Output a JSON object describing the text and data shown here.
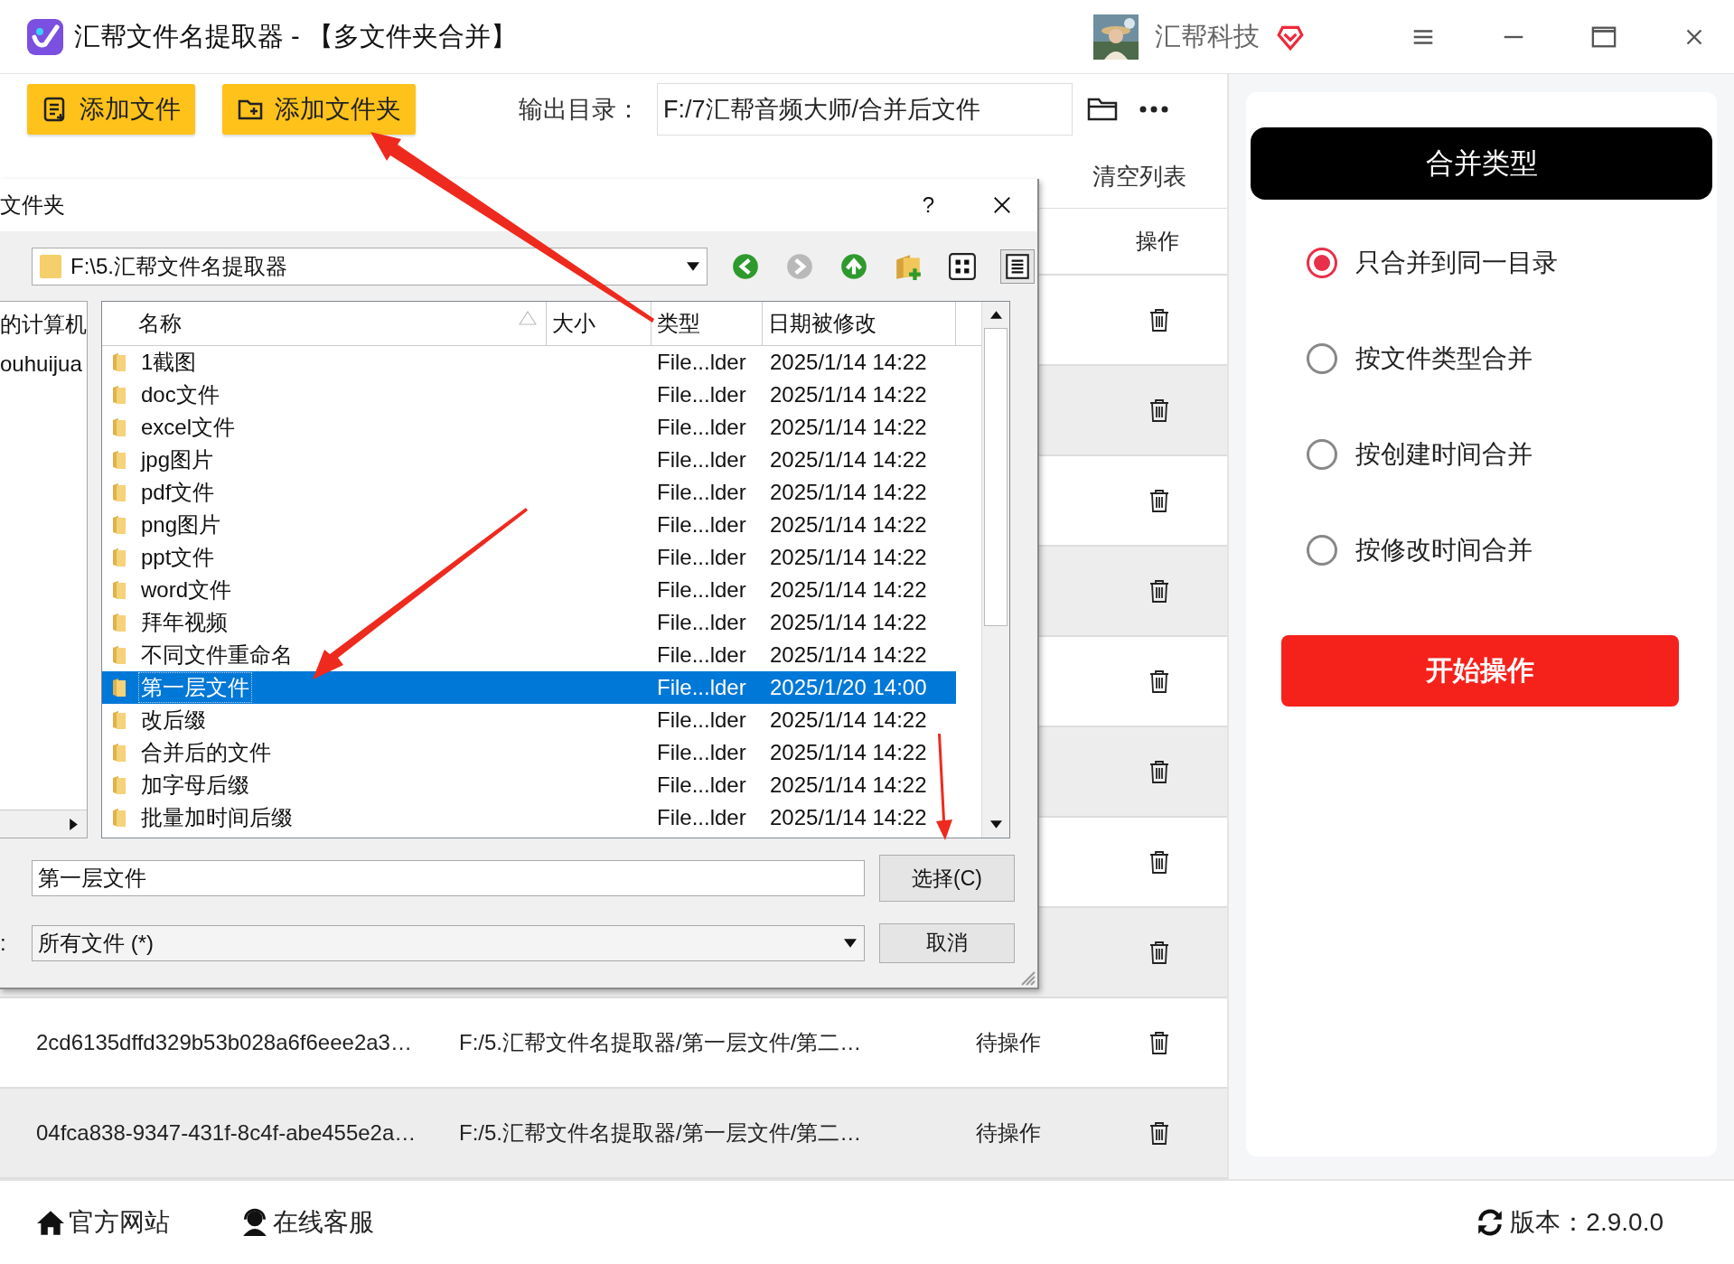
{
  "window": {
    "title": "汇帮文件名提取器 - 【多文件夹合并】",
    "user": "汇帮科技"
  },
  "toolbar": {
    "buttons": [
      {
        "label": "添加文件",
        "kind": "file"
      },
      {
        "label": "添加文件夹",
        "kind": "folder"
      }
    ],
    "output_label": "输出目录：",
    "output_path": "F:/7汇帮音频大师/合并后文件"
  },
  "clear_list": "清空列表",
  "table": {
    "action_column": "操作",
    "rows": [
      {
        "kind": "covered"
      },
      {
        "kind": "covered"
      },
      {
        "kind": "covered"
      },
      {
        "kind": "covered"
      },
      {
        "kind": "covered"
      },
      {
        "kind": "covered"
      },
      {
        "kind": "covered"
      },
      {
        "kind": "covered"
      },
      {
        "kind": "file",
        "name": "2cd6135dffd329b53b028a6f6eee2a3…",
        "path": "F:/5.汇帮文件名提取器/第一层文件/第二…",
        "status": "待操作"
      },
      {
        "kind": "file",
        "name": "04fca838-9347-431f-8c4f-abe455e2a…",
        "path": "F:/5.汇帮文件名提取器/第一层文件/第二…",
        "status": "待操作"
      }
    ]
  },
  "dialog": {
    "title": "文件夹",
    "help": "?",
    "path": "F:\\5.汇帮文件名提取器",
    "tree": [
      {
        "label": "的计算机"
      },
      {
        "label": "ouhuijua"
      }
    ],
    "columns": [
      "名称",
      "大小",
      "类型",
      "日期被修改"
    ],
    "files": [
      {
        "name": "1截图",
        "type": "File...lder",
        "modified": "2025/1/14 14:22",
        "selected": false
      },
      {
        "name": "doc文件",
        "type": "File...lder",
        "modified": "2025/1/14 14:22",
        "selected": false
      },
      {
        "name": "excel文件",
        "type": "File...lder",
        "modified": "2025/1/14 14:22",
        "selected": false
      },
      {
        "name": "jpg图片",
        "type": "File...lder",
        "modified": "2025/1/14 14:22",
        "selected": false
      },
      {
        "name": "pdf文件",
        "type": "File...lder",
        "modified": "2025/1/14 14:22",
        "selected": false
      },
      {
        "name": "png图片",
        "type": "File...lder",
        "modified": "2025/1/14 14:22",
        "selected": false
      },
      {
        "name": "ppt文件",
        "type": "File...lder",
        "modified": "2025/1/14 14:22",
        "selected": false
      },
      {
        "name": "word文件",
        "type": "File...lder",
        "modified": "2025/1/14 14:22",
        "selected": false
      },
      {
        "name": "拜年视频",
        "type": "File...lder",
        "modified": "2025/1/14 14:22",
        "selected": false
      },
      {
        "name": "不同文件重命名",
        "type": "File...lder",
        "modified": "2025/1/14 14:22",
        "selected": false
      },
      {
        "name": "第一层文件",
        "type": "File...lder",
        "modified": "2025/1/20 14:00",
        "selected": true
      },
      {
        "name": "改后缀",
        "type": "File...lder",
        "modified": "2025/1/14 14:22",
        "selected": false
      },
      {
        "name": "合并后的文件",
        "type": "File...lder",
        "modified": "2025/1/14 14:22",
        "selected": false
      },
      {
        "name": "加字母后缀",
        "type": "File...lder",
        "modified": "2025/1/14 14:22",
        "selected": false
      },
      {
        "name": "批量加时间后缀",
        "type": "File...lder",
        "modified": "2025/1/14 14:22",
        "selected": false
      }
    ],
    "filename": "第一层文件",
    "filter_label": ":",
    "filter": "所有文件 (*)",
    "select_button": "选择(C)",
    "cancel_button": "取消"
  },
  "merge_panel": {
    "title": "合并类型",
    "options": [
      {
        "label": "只合并到同一目录",
        "selected": true
      },
      {
        "label": "按文件类型合并",
        "selected": false
      },
      {
        "label": "按创建时间合并",
        "selected": false
      },
      {
        "label": "按修改时间合并",
        "selected": false
      }
    ],
    "start_button": "开始操作"
  },
  "footer": {
    "links": [
      {
        "label": "官方网站",
        "kind": "home"
      },
      {
        "label": "在线客服",
        "kind": "support"
      }
    ],
    "version": "版本：2.9.0.0"
  }
}
